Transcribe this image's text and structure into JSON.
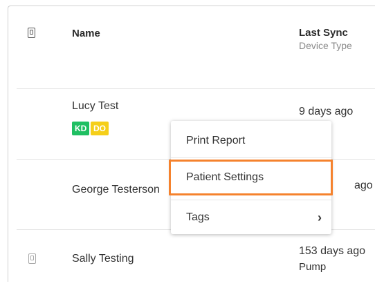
{
  "header": {
    "name_label": "Name",
    "last_sync_label": "Last Sync",
    "device_type_label": "Device Type"
  },
  "patients": [
    {
      "name": "Lucy Test",
      "tags": [
        {
          "label": "KD",
          "color": "#1fbf62"
        },
        {
          "label": "DO",
          "color": "#f5cf1a"
        }
      ],
      "last_sync": "9 days ago"
    },
    {
      "name": "George Testerson",
      "last_sync_partial": "ago"
    },
    {
      "name": "Sally Testing",
      "last_sync": "153 days ago",
      "device_type": "Pump"
    }
  ],
  "context_menu": {
    "items": [
      {
        "label": "Print Report"
      },
      {
        "label": "Patient Settings",
        "highlighted": true,
        "highlight_color": "#f5822d"
      },
      {
        "label": "Tags",
        "has_submenu": true
      }
    ]
  },
  "icons": {
    "header_device": "device-icon",
    "row_device": "device-icon",
    "submenu": "chevron-right-icon"
  }
}
